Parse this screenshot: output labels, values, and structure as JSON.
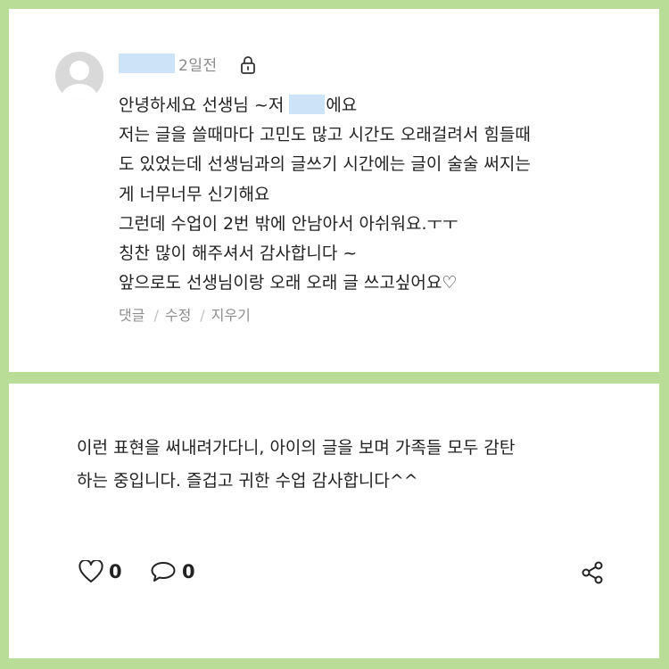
{
  "comment": {
    "time": "2일전",
    "lines": [
      "안녕하세요 선생님 ~저",
      "에요",
      "저는 글을 쓸때마다 고민도 많고 시간도 오래걸려서 힘들때",
      "도 있었는데 선생님과의 글쓰기 시간에는 글이 술술 써지는",
      "게 너무너무 신기해요",
      "그런데 수업이 2번 밖에 안남아서 아쉬워요.ㅜㅜ",
      "칭찬 많이 해주셔서 감사합니다 ~",
      "앞으로도 선생님이랑 오래 오래 글 쓰고싶어요♡"
    ],
    "actions": {
      "reply": "댓글",
      "edit": "수정",
      "delete": "지우기",
      "separator": "/"
    }
  },
  "reply": {
    "lines": [
      "이런 표현을 써내려가다니, 아이의 글을 보며 가족들 모두 감탄",
      "하는 중입니다. 즐겁고 귀한 수업 감사합니다^^"
    ]
  },
  "stats": {
    "likes": "0",
    "comments": "0"
  },
  "icons": {
    "lock": "lock-icon",
    "like": "heart-icon",
    "comment": "speech-bubble-icon",
    "share": "share-icon",
    "avatar": "default-avatar-icon"
  },
  "colors": {
    "background": "#b9dd96",
    "redaction": "#cde4f8",
    "muted": "#8a8a8a"
  }
}
